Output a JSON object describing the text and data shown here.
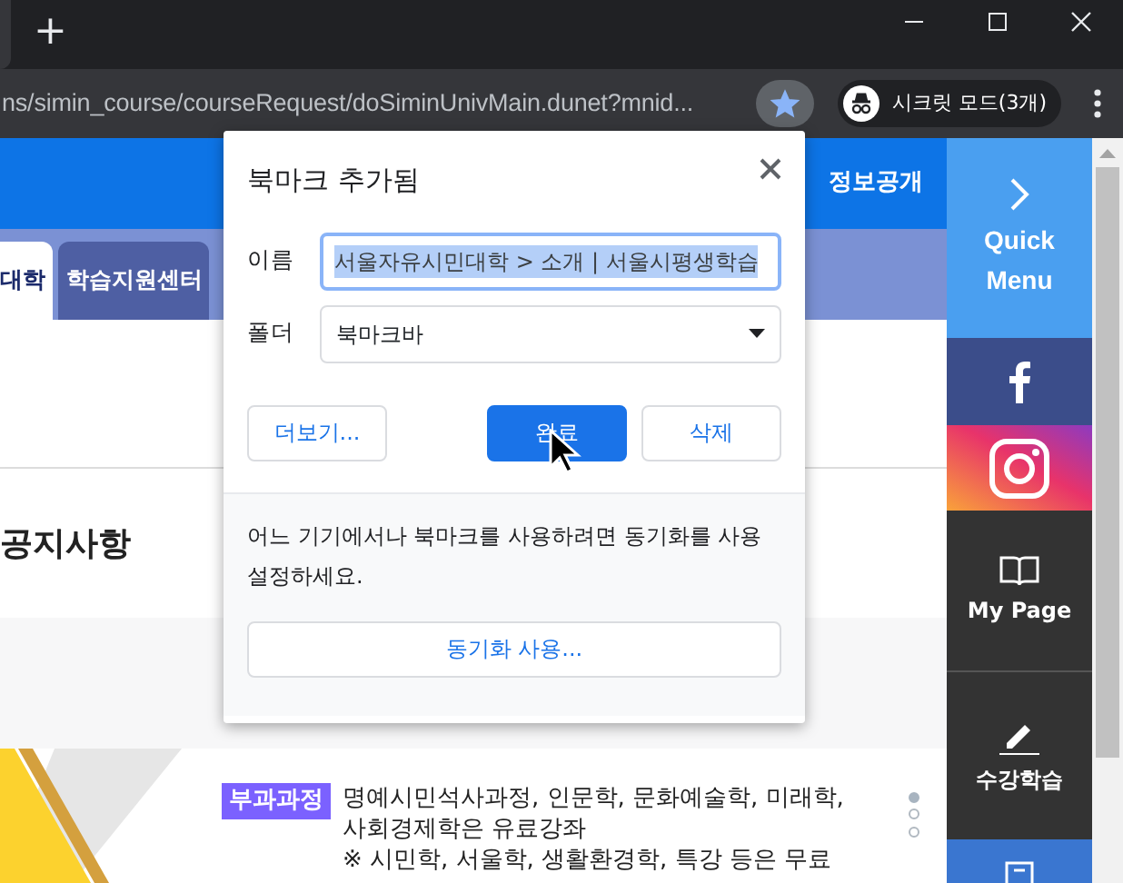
{
  "browser": {
    "new_tab": "+",
    "url": "ns/simin_course/courseRequest/doSiminUnivMain.dunet?mnid...",
    "bookmarked": true,
    "profile": "시크릿 모드(3개)"
  },
  "site": {
    "header_link": "정보공개",
    "tabs": [
      {
        "label": "대학",
        "selected": true
      },
      {
        "label": "학습지원센터",
        "selected": false
      }
    ],
    "section_title": "공지사항",
    "notice": {
      "badge": "부과과정",
      "lines": [
        "명예시민석사과정, 인문학, 문화예술학, 미래학,",
        "사회경제학은 유료강좌",
        "※ 시민학, 서울학, 생활환경학, 특강 등은 무료"
      ]
    },
    "carousel_dots": [
      {
        "selected": true
      },
      {
        "selected": false
      },
      {
        "selected": false
      }
    ],
    "quick_menu": [
      {
        "kind": "toggle",
        "label": "Quick Menu"
      },
      {
        "kind": "facebook"
      },
      {
        "kind": "instagram"
      },
      {
        "kind": "book",
        "label": "My Page"
      },
      {
        "kind": "pencil",
        "label": "수강학습"
      },
      {
        "kind": "document"
      }
    ]
  },
  "dialog": {
    "title": "북마크 추가됨",
    "name_label": "이름",
    "name_value": "서울자유시민대학 > 소개 | 서울시평생학습",
    "name_selected": true,
    "folder_label": "폴더",
    "folder_value": "북마크바",
    "buttons": [
      {
        "label": "더보기...",
        "kind": "secondary"
      },
      {
        "label": "완료",
        "kind": "primary"
      },
      {
        "label": "삭제",
        "kind": "secondary"
      }
    ],
    "sync_message": "어느 기기에서나 북마크를 사용하려면 동기화를 사용 설정하세요.",
    "sync_button": "동기화 사용..."
  }
}
